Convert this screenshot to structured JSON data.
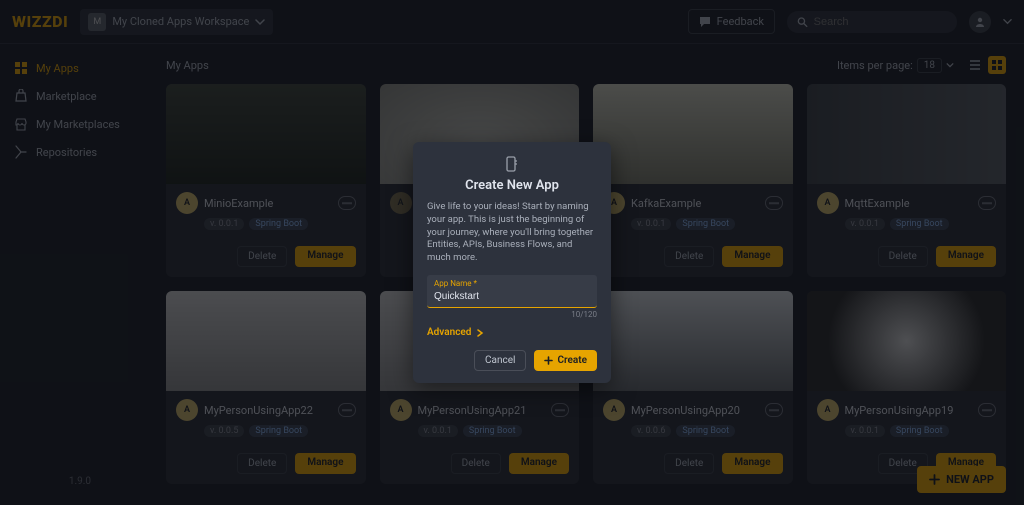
{
  "brand": "WIZZDI",
  "workspace": {
    "initial": "M",
    "name": "My Cloned Apps Workspace"
  },
  "topbar": {
    "feedback": "Feedback",
    "search_placeholder": "Search"
  },
  "sidebar": {
    "items": [
      {
        "label": "My Apps"
      },
      {
        "label": "Marketplace"
      },
      {
        "label": "My Marketplaces"
      },
      {
        "label": "Repositories"
      }
    ]
  },
  "version": "1.9.0",
  "main": {
    "breadcrumb": "My Apps",
    "items_per_page_label": "Items per page:",
    "items_per_page_value": "18"
  },
  "buttons": {
    "delete": "Delete",
    "manage": "Manage",
    "new_app": "NEW APP"
  },
  "apps": [
    {
      "name": "MinioExample",
      "version": "v. 0.0.1",
      "framework": "Spring Boot"
    },
    {
      "name": "KafkaExample",
      "version": "v. 0.0.1",
      "framework": "Spring Boot"
    },
    {
      "name": "MqttExample",
      "version": "v. 0.0.1",
      "framework": "Spring Boot"
    },
    {
      "name": "MyPersonUsingApp22",
      "version": "v. 0.0.5",
      "framework": "Spring Boot"
    },
    {
      "name": "MyPersonUsingApp21",
      "version": "v. 0.0.1",
      "framework": "Spring Boot"
    },
    {
      "name": "MyPersonUsingApp20",
      "version": "v. 0.0.6",
      "framework": "Spring Boot"
    },
    {
      "name": "MyPersonUsingApp19",
      "version": "v. 0.0.1",
      "framework": "Spring Boot"
    }
  ],
  "modal": {
    "title": "Create New App",
    "description": "Give life to your ideas! Start by naming your app. This is just the beginning of your journey, where you'll bring together Entities, APIs, Business Flows, and much more.",
    "field_label": "App Name *",
    "field_value": "Quickstart",
    "counter": "10/120",
    "advanced": "Advanced",
    "cancel": "Cancel",
    "create": "Create"
  }
}
